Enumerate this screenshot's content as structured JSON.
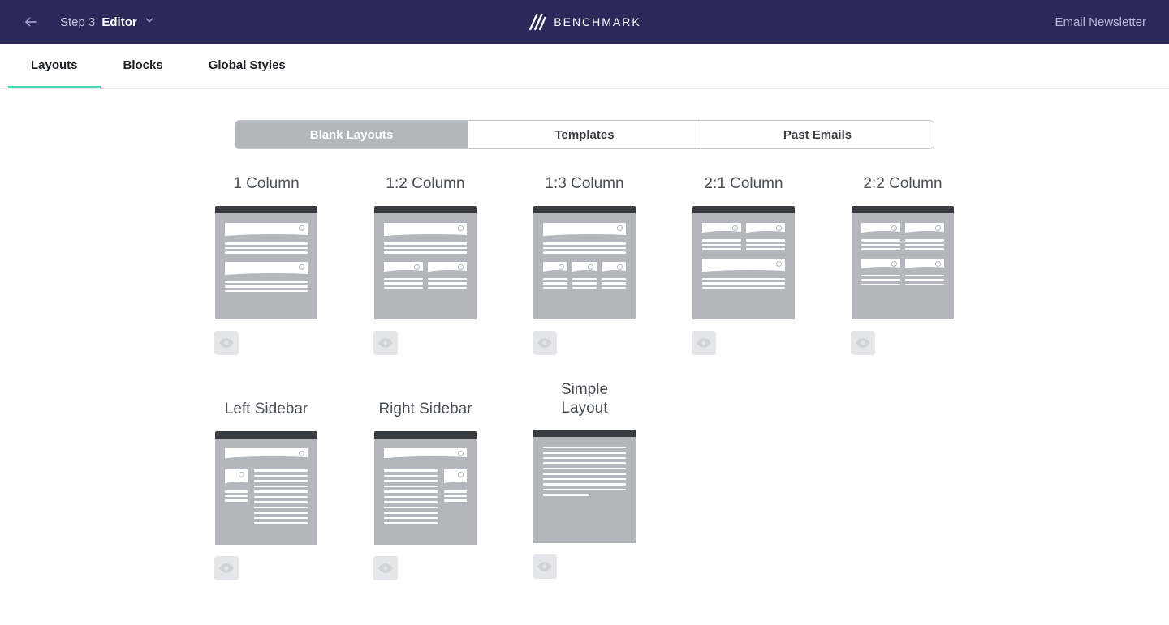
{
  "header": {
    "step_prefix": "Step 3",
    "step_name": "Editor",
    "brand": "BENCHMARK",
    "doc_title": "Email Newsletter"
  },
  "nav_tabs": {
    "a": "Layouts",
    "b": "Blocks",
    "c": "Global Styles"
  },
  "seg": {
    "a": "Blank Layouts",
    "b": "Templates",
    "c": "Past Emails"
  },
  "layouts": {
    "c1": "1 Column",
    "c2": "1:2 Column",
    "c3": "1:3 Column",
    "c4": "2:1 Column",
    "c5": "2:2 Column",
    "c6": "Left Sidebar",
    "c7": "Right Sidebar",
    "c8": "Simple\nLayout"
  }
}
